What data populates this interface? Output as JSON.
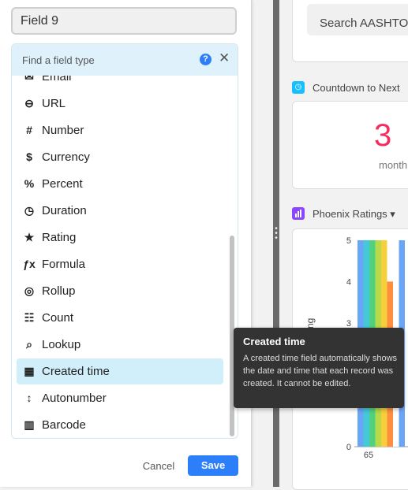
{
  "field_panel": {
    "field_name_value": "Field 9",
    "search_placeholder": "Find a field type",
    "help_icon": "?",
    "close_icon": "✕",
    "field_types": [
      {
        "label": "Email",
        "icon": "email-icon",
        "glyph": "✉",
        "selected": false
      },
      {
        "label": "URL",
        "icon": "link-icon",
        "glyph": "⊖",
        "selected": false
      },
      {
        "label": "Number",
        "icon": "number-icon",
        "glyph": "#",
        "selected": false
      },
      {
        "label": "Currency",
        "icon": "currency-icon",
        "glyph": "$",
        "selected": false
      },
      {
        "label": "Percent",
        "icon": "percent-icon",
        "glyph": "%",
        "selected": false
      },
      {
        "label": "Duration",
        "icon": "clock-icon",
        "glyph": "◷",
        "selected": false
      },
      {
        "label": "Rating",
        "icon": "star-icon",
        "glyph": "★",
        "selected": false
      },
      {
        "label": "Formula",
        "icon": "formula-icon",
        "glyph": "ƒx",
        "selected": false
      },
      {
        "label": "Rollup",
        "icon": "rollup-icon",
        "glyph": "◎",
        "selected": false
      },
      {
        "label": "Count",
        "icon": "count-icon",
        "glyph": "☷",
        "selected": false
      },
      {
        "label": "Lookup",
        "icon": "lookup-icon",
        "glyph": "⌕",
        "selected": false
      },
      {
        "label": "Created time",
        "icon": "created-time-icon",
        "glyph": "▦",
        "selected": true
      },
      {
        "label": "Autonumber",
        "icon": "autonumber-icon",
        "glyph": "↕",
        "selected": false
      },
      {
        "label": "Barcode",
        "icon": "barcode-icon",
        "glyph": "▥",
        "selected": false
      }
    ],
    "cancel_label": "Cancel",
    "save_label": "Save"
  },
  "dashboard": {
    "search_label": "Search  AASHTO",
    "countdown_title": "Countdown to Next",
    "countdown_icon": "clock-icon",
    "countdown_value": "3",
    "countdown_unit": "month",
    "ratings_title": "Phoenix Ratings ▾",
    "ratings_icon": "bar-chart-icon"
  },
  "tooltip": {
    "title": "Created time",
    "body": "A created time field automatically shows the date and time that each record was created. It cannot be edited."
  },
  "colors": {
    "accent": "#2d7ff9",
    "selected_row": "#d1eefb",
    "picker_header": "#dff2fb",
    "countdown_number": "#f82b60"
  },
  "chart_data": {
    "type": "bar",
    "ylabel": "Rating",
    "y_ticks": [
      "0",
      "3",
      "4",
      "5"
    ],
    "ylim": [
      0,
      5
    ],
    "categories": [
      "65"
    ],
    "series": [
      {
        "values": [
          5
        ],
        "color": "#6aa6f8"
      },
      {
        "values": [
          5
        ],
        "color": "#45c8d8"
      },
      {
        "values": [
          5
        ],
        "color": "#4fd17f"
      },
      {
        "values": [
          5
        ],
        "color": "#b7d94a"
      },
      {
        "values": [
          5
        ],
        "color": "#f7cf3b"
      },
      {
        "values": [
          4
        ],
        "color": "#ff8f3d"
      },
      {
        "values": [
          5
        ],
        "color": "#ffffff"
      },
      {
        "values": [
          5
        ],
        "color": "#6aa6f8"
      }
    ]
  }
}
